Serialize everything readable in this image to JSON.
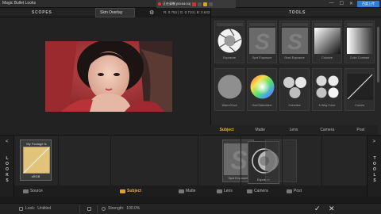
{
  "window": {
    "title": "Magic Bullet Looks",
    "recorder_text": "正在录制 [00:04:04]",
    "min_label": "—",
    "max_label": "☐",
    "close_label": "✕",
    "app_badge": "百度上传"
  },
  "scopes": {
    "header": "SCOPES",
    "tab_label": "Skin Overlay",
    "settings_icon": "gear-icon",
    "readout": "R: 0.783 | G: 0.710 | B: 0.643"
  },
  "tools_panel": {
    "header": "TOOLS",
    "tools": [
      {
        "label": "Exposure",
        "icon": "aperture-icon"
      },
      {
        "label": "Spot Exposure",
        "icon": "s-icon"
      },
      {
        "label": "Grad Exposure",
        "icon": "s-icon"
      },
      {
        "label": "Colorize",
        "icon": "gradient-icon"
      },
      {
        "label": "Color Contrast",
        "icon": "gradient-icon"
      },
      {
        "label": "Warm/Cool",
        "icon": "circle-icon"
      },
      {
        "label": "Hue/Saturation",
        "icon": "color-wheel-icon"
      },
      {
        "label": "Colorista",
        "icon": "three-way-icon"
      },
      {
        "label": "4-Way Color",
        "icon": "four-way-icon"
      },
      {
        "label": "Curves",
        "icon": "curve-icon"
      }
    ],
    "categories": [
      "Subject",
      "Matte",
      "Lens",
      "Camera",
      "Post"
    ],
    "active_category": "Subject"
  },
  "looks_side": {
    "arrow": "<",
    "letters": [
      "L",
      "O",
      "O",
      "K",
      "S"
    ]
  },
  "tools_side": {
    "arrow": ">",
    "letters": [
      "T",
      "O",
      "O",
      "L",
      "S"
    ]
  },
  "chain": {
    "footage_label": "My Footage Is",
    "footage_sub": "sRGB",
    "source_label": "Source",
    "stack_labels": [
      "Spot Exposure",
      "Exposure"
    ],
    "categories": [
      "Subject",
      "Matte",
      "Lens",
      "Camera",
      "Post"
    ],
    "active_category": "Subject"
  },
  "status": {
    "look_label": "Look:",
    "look_value": "Untitled",
    "strength_label": "Strength:",
    "strength_value": "100.0%",
    "ok_icon": "check-icon",
    "cancel_icon": "x-icon"
  },
  "colors": {
    "accent": "#f0b040",
    "panel": "#262626",
    "background": "#1b1b1b"
  }
}
